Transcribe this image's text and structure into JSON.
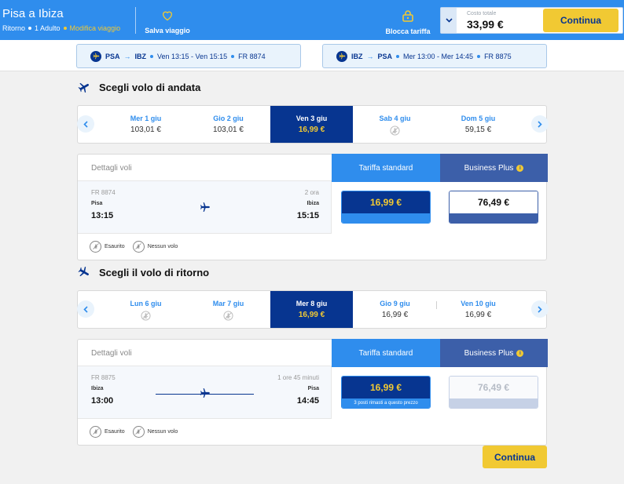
{
  "header": {
    "title": "Pisa a Ibiza",
    "trip_type": "Ritorno",
    "passengers": "1 Adulto",
    "modify_link": "Modifica viaggio",
    "save_label": "Salva viaggio",
    "lock_label": "Blocca tariffa",
    "total_label": "Costo totale",
    "total_value": "33,99 €",
    "continue_label": "Continua"
  },
  "summary": {
    "outbound": {
      "from": "PSA",
      "to": "IBZ",
      "dates": "Ven 13:15 - Ven 15:15",
      "flight": "FR 8874"
    },
    "return": {
      "from": "IBZ",
      "to": "PSA",
      "dates": "Mer 13:00 - Mer 14:45",
      "flight": "FR 8875"
    }
  },
  "outbound": {
    "title": "Scegli volo di andata",
    "dates": [
      {
        "label": "Mer 1 giu",
        "price": "103,01 €"
      },
      {
        "label": "Gio 2 giu",
        "price": "103,01 €"
      },
      {
        "label": "Ven 3 giu",
        "price": "16,99 €"
      },
      {
        "label": "Sab 4 giu",
        "price": ""
      },
      {
        "label": "Dom 5 giu",
        "price": "59,15 €"
      }
    ],
    "details_label": "Dettagli voli",
    "standard_label": "Tariffa standard",
    "business_label": "Business Plus",
    "flight_number": "FR 8874",
    "duration": "2 ora",
    "from_city": "Pisa",
    "to_city": "Ibiza",
    "dep_time": "13:15",
    "arr_time": "15:15",
    "standard_price": "16,99 €",
    "standard_note": "",
    "business_price": "76,49 €",
    "legend_sold_out": "Esaurito",
    "legend_no_flight": "Nessun volo"
  },
  "return": {
    "title": "Scegli il volo di ritorno",
    "dates": [
      {
        "label": "Lun 6 giu",
        "price": ""
      },
      {
        "label": "Mar 7 giu",
        "price": ""
      },
      {
        "label": "Mer 8 giu",
        "price": "16,99 €"
      },
      {
        "label": "Gio 9 giu",
        "price": "16,99 €"
      },
      {
        "label": "Ven 10 giu",
        "price": "16,99 €"
      }
    ],
    "details_label": "Dettagli voli",
    "standard_label": "Tariffa standard",
    "business_label": "Business Plus",
    "flight_number": "FR 8875",
    "duration": "1 ore 45 minuti",
    "from_city": "Ibiza",
    "to_city": "Pisa",
    "dep_time": "13:00",
    "arr_time": "14:45",
    "standard_price": "16,99 €",
    "standard_note": "3 posti rimasti a questo prezzo",
    "business_price": "76,49 €",
    "legend_sold_out": "Esaurito",
    "legend_no_flight": "Nessun volo"
  },
  "footer": {
    "continue_label": "Continua"
  },
  "colors": {
    "primary_blue": "#2f8ded",
    "navy": "#073590",
    "yellow": "#f1c933",
    "business_blue": "#3c5fa9"
  }
}
